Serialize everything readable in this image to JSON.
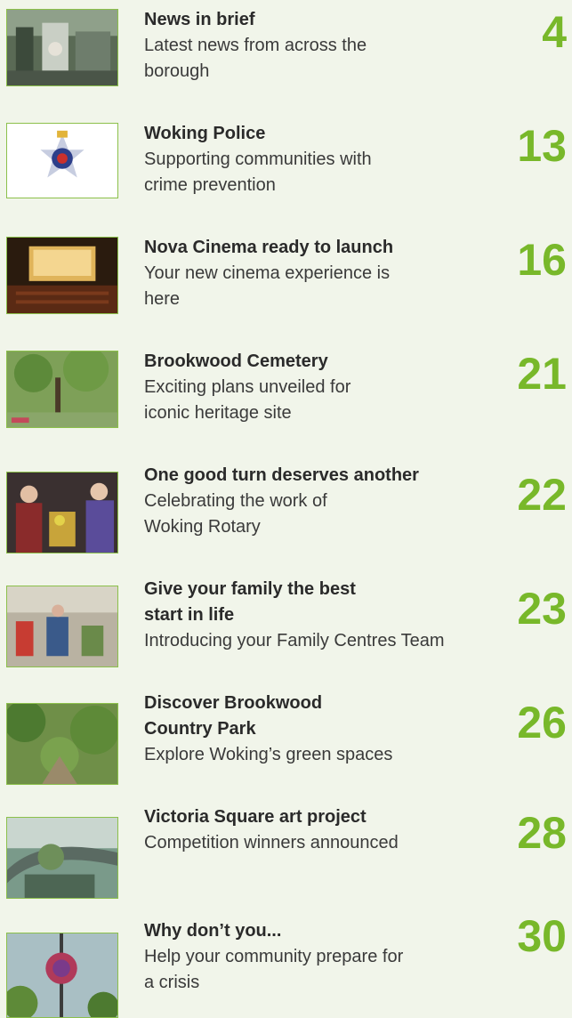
{
  "entries": [
    {
      "title": "News in brief",
      "subtitle": "Latest news from across the borough",
      "page": "4",
      "image": "street-market-photo"
    },
    {
      "title": "Woking Police",
      "subtitle": "Supporting communities with crime prevention",
      "page": "13",
      "image": "police-badge-image"
    },
    {
      "title": "Nova Cinema ready to launch",
      "subtitle": "Your new cinema experience is here",
      "page": "16",
      "image": "cinema-photo"
    },
    {
      "title": "Brookwood Cemetery",
      "subtitle": "Exciting plans unveiled for iconic heritage site",
      "page": "21",
      "image": "cemetery-photo"
    },
    {
      "title": "One good turn deserves another",
      "subtitle": "Celebrating the work of Woking Rotary",
      "page": "22",
      "image": "rotary-people-photo"
    },
    {
      "title": "Give your family the best start in life",
      "subtitle": "Introducing your Family Centres Team",
      "page": "23",
      "image": "family-centre-photo"
    },
    {
      "title": "Discover Brookwood Country Park",
      "subtitle": "Explore Woking’s green spaces",
      "page": "26",
      "image": "country-park-photo"
    },
    {
      "title": "Victoria Square art project",
      "subtitle": "Competition winners announced",
      "page": "28",
      "image": "art-project-photo"
    },
    {
      "title": "Why don’t you...",
      "subtitle": "Help your community prepare for a crisis",
      "page": "30",
      "image": "hanging-basket-photo"
    }
  ],
  "colors": {
    "background": "#f1f5ea",
    "accent_green": "#78b82a",
    "thumb_border": "#8cc04b"
  }
}
